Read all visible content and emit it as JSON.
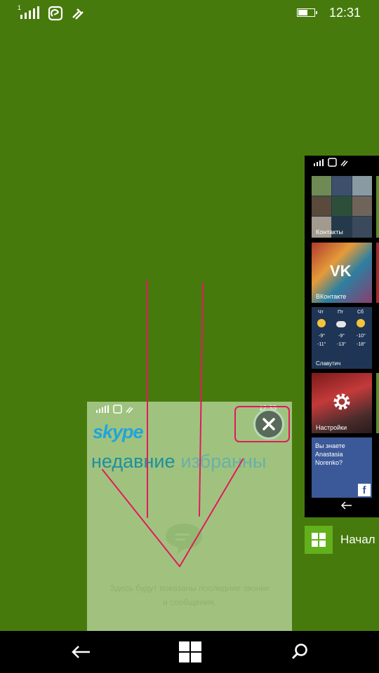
{
  "status_bar": {
    "time": "12:31",
    "signal_icon": "signal-strength-icon",
    "data_icon": "data-sync-icon",
    "wifi_icon": "wifi-icon",
    "battery_level": 0.6
  },
  "skype_card": {
    "app_name": "skype",
    "tabs": [
      {
        "label": "недавние"
      },
      {
        "label": "избранны"
      }
    ],
    "empty_message_line1": "Здесь будут показаны последние звонки",
    "empty_message_line2": "и сообщения.",
    "mini_time": "12:35"
  },
  "start_card": {
    "tiles": [
      {
        "label": "Контакты",
        "icon": "people-icon"
      },
      {
        "label": "ВКонтакте",
        "icon": "vk-icon"
      },
      {
        "label": "Славутич",
        "days": [
          "Чт",
          "Пт",
          "Сб"
        ],
        "highs": [
          "-9°",
          "-9°",
          "-10°"
        ],
        "lows": [
          "-11°",
          "-13°",
          "-18°"
        ]
      },
      {
        "label": "Настройки",
        "icon": "gear-icon"
      },
      {
        "label": "Вы знаете Anastasia Norenko?",
        "icon": "facebook-icon"
      }
    ],
    "caption": "Начал"
  },
  "colors": {
    "accent": "#477a0d",
    "annotation": "#e11a5c",
    "skype_blue": "#22a4dc",
    "start_green": "#62b01c"
  },
  "nav_bar": {
    "back_icon": "back-arrow-icon",
    "start_icon": "windows-logo-icon",
    "search_icon": "search-icon"
  }
}
